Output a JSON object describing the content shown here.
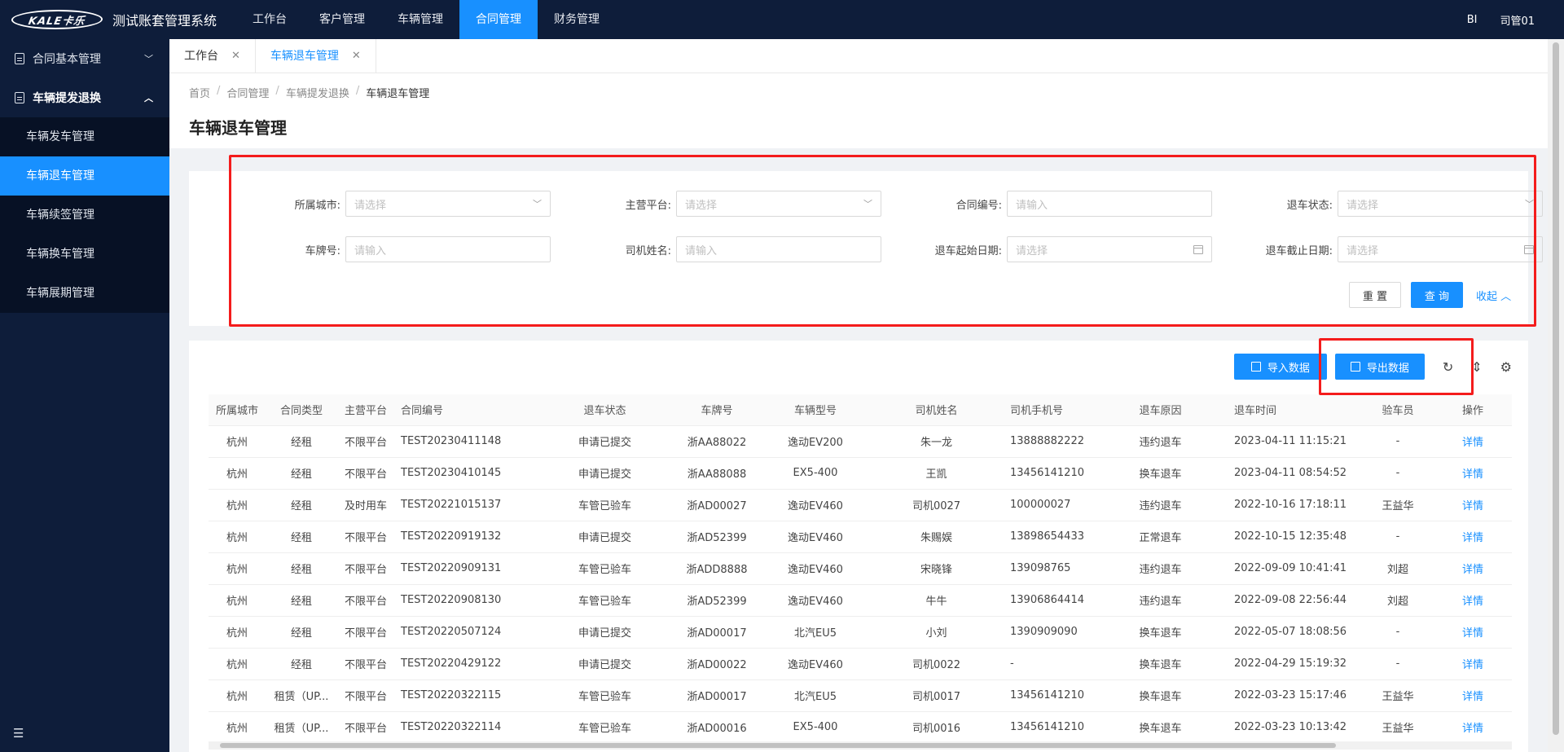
{
  "app": {
    "logo_text": "KALE卡乐",
    "title": "测试账套管理系统",
    "nav": [
      "工作台",
      "客户管理",
      "车辆管理",
      "合同管理",
      "财务管理"
    ],
    "active_nav": "合同管理",
    "bi": "BI",
    "user": "司管01"
  },
  "sidebar": {
    "groups": [
      {
        "label": "合同基本管理",
        "chevron": "chevron-down"
      },
      {
        "label": "车辆提发退换",
        "chevron": "chevron-up"
      }
    ],
    "items": [
      "车辆发车管理",
      "车辆退车管理",
      "车辆续签管理",
      "车辆换车管理",
      "车辆展期管理"
    ],
    "active_item": "车辆退车管理"
  },
  "tabs": [
    "工作台",
    "车辆退车管理"
  ],
  "breadcrumb": [
    "首页",
    "合同管理",
    "车辆提发退换",
    "车辆退车管理"
  ],
  "page_title": "车辆退车管理",
  "filters": {
    "city": {
      "label": "所属城市:",
      "placeholder": "请选择"
    },
    "platform": {
      "label": "主营平台:",
      "placeholder": "请选择"
    },
    "contract_no": {
      "label": "合同编号:",
      "placeholder": "请输入"
    },
    "status": {
      "label": "退车状态:",
      "placeholder": "请选择"
    },
    "plate": {
      "label": "车牌号:",
      "placeholder": "请输入"
    },
    "driver": {
      "label": "司机姓名:",
      "placeholder": "请输入"
    },
    "start_date": {
      "label": "退车起始日期:",
      "placeholder": "请选择"
    },
    "end_date": {
      "label": "退车截止日期:",
      "placeholder": "请选择"
    },
    "reset": "重 置",
    "search": "查 询",
    "collapse": "收起"
  },
  "toolbar": {
    "import": "导入数据",
    "export": "导出数据"
  },
  "table": {
    "columns": [
      "所属城市",
      "合同类型",
      "主营平台",
      "合同编号",
      "退车状态",
      "车牌号",
      "车辆型号",
      "司机姓名",
      "司机手机号",
      "退车原因",
      "退车时间",
      "验车员",
      "操作"
    ],
    "rows": [
      [
        "杭州",
        "经租",
        "不限平台",
        "TEST20230411148",
        "申请已提交",
        "浙AA88022",
        "逸动EV200",
        "朱一龙",
        "13888882222",
        "违约退车",
        "2023-04-11 11:15:21",
        "-",
        "详情"
      ],
      [
        "杭州",
        "经租",
        "不限平台",
        "TEST20230410145",
        "申请已提交",
        "浙AA88088",
        "EX5-400",
        "王凯",
        "13456141210",
        "换车退车",
        "2023-04-11 08:54:52",
        "-",
        "详情"
      ],
      [
        "杭州",
        "经租",
        "及时用车",
        "TEST20221015137",
        "车管已验车",
        "浙AD00027",
        "逸动EV460",
        "司机0027",
        "100000027",
        "违约退车",
        "2022-10-16 17:18:11",
        "王益华",
        "详情"
      ],
      [
        "杭州",
        "经租",
        "不限平台",
        "TEST20220919132",
        "申请已提交",
        "浙AD52399",
        "逸动EV460",
        "朱赐娱",
        "13898654433",
        "正常退车",
        "2022-10-15 12:35:48",
        "-",
        "详情"
      ],
      [
        "杭州",
        "经租",
        "不限平台",
        "TEST20220909131",
        "车管已验车",
        "浙ADD8888",
        "逸动EV460",
        "宋晓锋",
        "139098765",
        "违约退车",
        "2022-09-09 10:41:41",
        "刘超",
        "详情"
      ],
      [
        "杭州",
        "经租",
        "不限平台",
        "TEST20220908130",
        "车管已验车",
        "浙AD52399",
        "逸动EV460",
        "牛牛",
        "13906864414",
        "违约退车",
        "2022-09-08 22:56:44",
        "刘超",
        "详情"
      ],
      [
        "杭州",
        "经租",
        "不限平台",
        "TEST20220507124",
        "申请已提交",
        "浙AD00017",
        "北汽EU5",
        "小刘",
        "1390909090",
        "换车退车",
        "2022-05-07 18:08:56",
        "-",
        "详情"
      ],
      [
        "杭州",
        "经租",
        "不限平台",
        "TEST20220429122",
        "申请已提交",
        "浙AD00022",
        "逸动EV460",
        "司机0022",
        "-",
        "换车退车",
        "2022-04-29 15:19:32",
        "-",
        "详情"
      ],
      [
        "杭州",
        "租赁（UP...",
        "不限平台",
        "TEST20220322115",
        "车管已验车",
        "浙AD00017",
        "北汽EU5",
        "司机0017",
        "13456141210",
        "换车退车",
        "2022-03-23 15:17:46",
        "王益华",
        "详情"
      ],
      [
        "杭州",
        "租赁（UP...",
        "不限平台",
        "TEST20220322114",
        "车管已验车",
        "浙AD00016",
        "EX5-400",
        "司机0016",
        "13456141210",
        "换车退车",
        "2022-03-23 10:13:42",
        "王益华",
        "详情"
      ]
    ]
  },
  "colors": {
    "nav_bg": "#0e1d3a",
    "accent": "#1890ff",
    "highlight": "#f41c1c"
  }
}
